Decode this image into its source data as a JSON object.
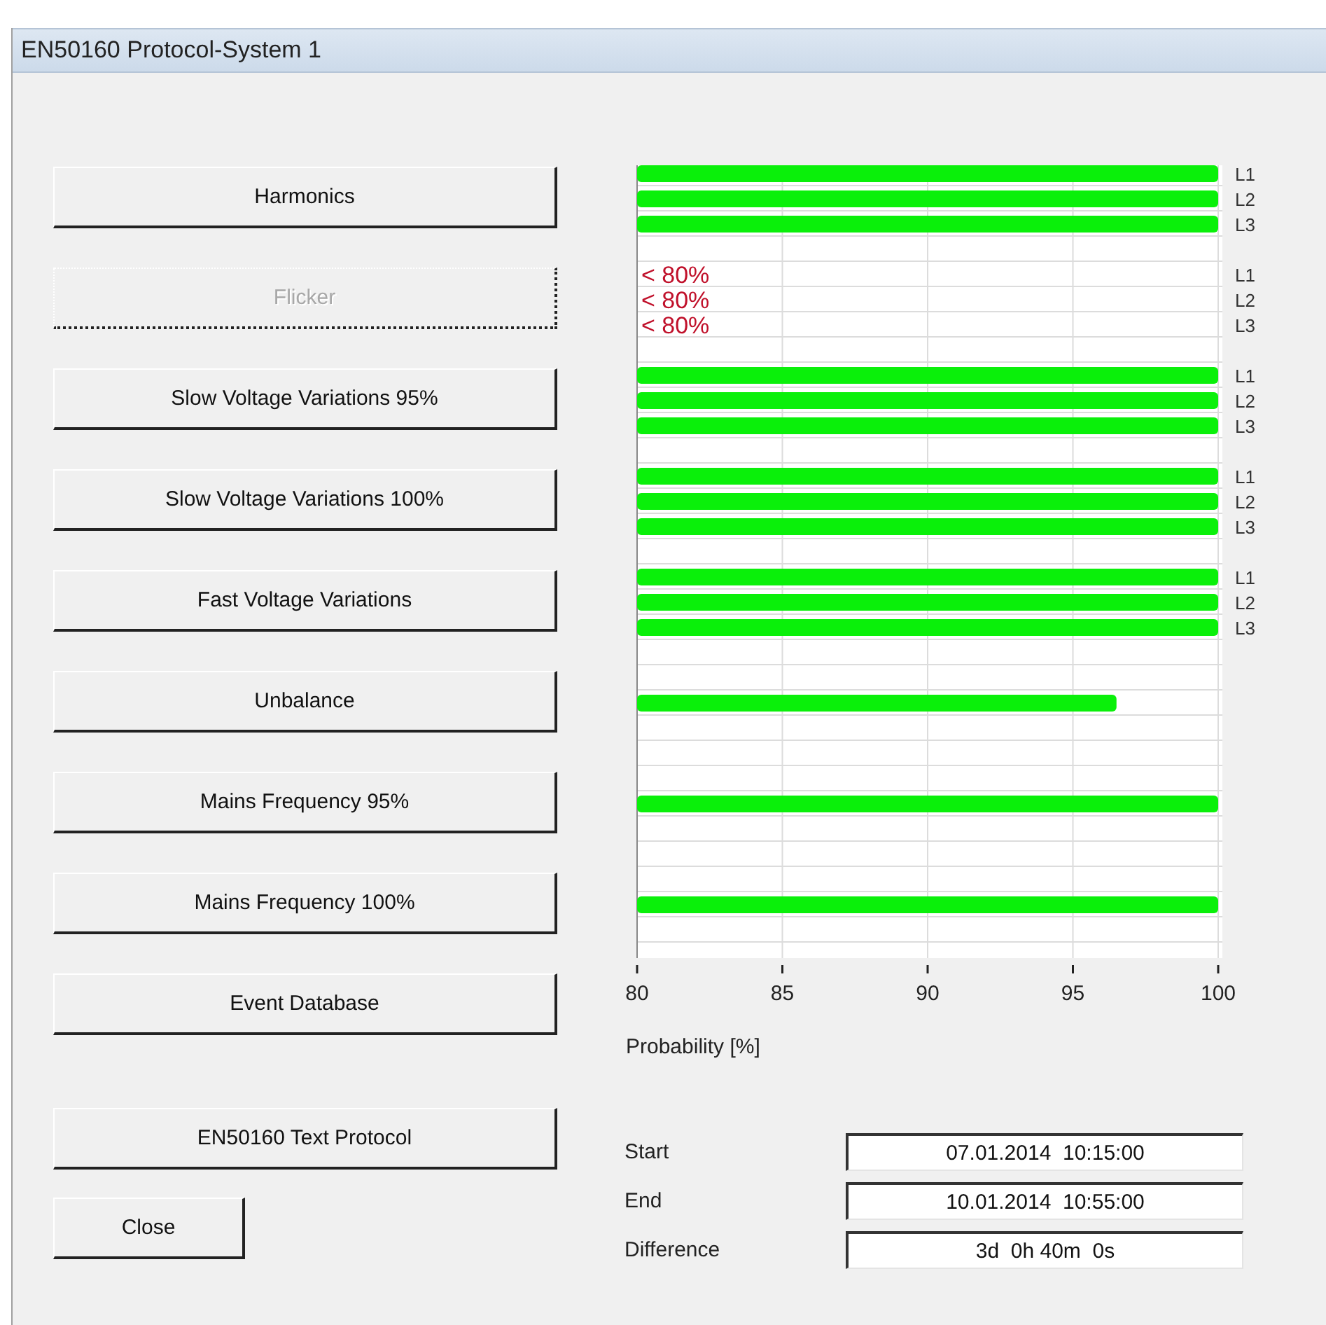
{
  "window": {
    "title": "EN50160 Protocol-System 1"
  },
  "buttons": [
    {
      "label": "Harmonics",
      "disabled": false
    },
    {
      "label": "Flicker",
      "disabled": true
    },
    {
      "label": "Slow Voltage Variations 95%",
      "disabled": false
    },
    {
      "label": "Slow Voltage Variations 100%",
      "disabled": false
    },
    {
      "label": "Fast Voltage Variations",
      "disabled": false
    },
    {
      "label": "Unbalance",
      "disabled": false
    },
    {
      "label": "Mains Frequency 95%",
      "disabled": false
    },
    {
      "label": "Mains Frequency 100%",
      "disabled": false
    },
    {
      "label": "Event Database",
      "disabled": false
    }
  ],
  "protocol_button": {
    "label": "EN50160 Text Protocol"
  },
  "close_button": {
    "label": "Close"
  },
  "chart": {
    "chart_data": {
      "type": "bar",
      "orientation": "horizontal",
      "xlabel": "Probability [%]",
      "xlim": [
        80,
        100
      ],
      "xticks": [
        80,
        85,
        90,
        95,
        100
      ],
      "grid": true,
      "categories": [
        "L1",
        "L2",
        "L3",
        null,
        "L1",
        "L2",
        "L3",
        null,
        "L1",
        "L2",
        "L3",
        null,
        "L1",
        "L2",
        "L3",
        null,
        "L1",
        "L2",
        "L3",
        null,
        null,
        null,
        null,
        null,
        null,
        null,
        null,
        null,
        null,
        null,
        null
      ],
      "series": [
        {
          "color": "#0af00a",
          "values": [
            100,
            100,
            100,
            null,
            null,
            null,
            null,
            null,
            100,
            100,
            100,
            null,
            100,
            100,
            100,
            null,
            100,
            100,
            100,
            null,
            null,
            96.5,
            null,
            null,
            null,
            100,
            null,
            null,
            null,
            100,
            null
          ]
        }
      ],
      "value_labels": [
        null,
        null,
        null,
        null,
        "< 80%",
        "< 80%",
        "< 80%",
        null,
        null,
        null,
        null,
        null,
        null,
        null,
        null,
        null,
        null,
        null,
        null,
        null,
        null,
        null,
        null,
        null,
        null,
        null,
        null,
        null,
        null,
        null,
        null
      ]
    }
  },
  "times": [
    {
      "label": "Start",
      "value": "07.01.2014  10:15:00"
    },
    {
      "label": "End",
      "value": "10.01.2014  10:55:00"
    },
    {
      "label": "Difference",
      "value": "3d  0h 40m  0s"
    }
  ]
}
